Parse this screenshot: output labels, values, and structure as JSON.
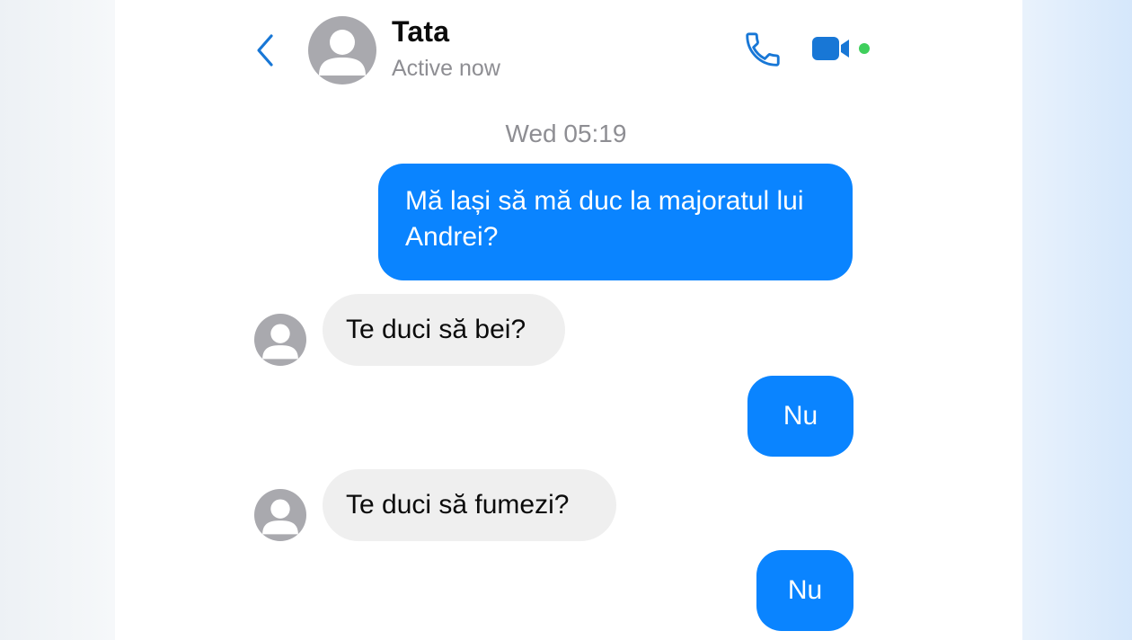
{
  "header": {
    "contact_name": "Tata",
    "status": "Active now",
    "icons": {
      "back": "chevron-left-icon",
      "avatar": "person-avatar-icon",
      "call": "phone-icon",
      "video": "video-camera-icon"
    }
  },
  "conversation": {
    "timestamp": "Wed 05:19",
    "messages": [
      {
        "direction": "outgoing",
        "text": "Mă lași să mă duc la majoratul lui Andrei?"
      },
      {
        "direction": "incoming",
        "text": "Te duci să bei?"
      },
      {
        "direction": "outgoing",
        "text": "Nu"
      },
      {
        "direction": "incoming",
        "text": "Te duci să fumezi?"
      },
      {
        "direction": "outgoing",
        "text": "Nu"
      }
    ]
  },
  "colors": {
    "accent": "#0A84FF",
    "incoming_bubble": "#EFEFEF",
    "secondary_text": "#8E8E93",
    "active_dot": "#3FCF5C"
  }
}
